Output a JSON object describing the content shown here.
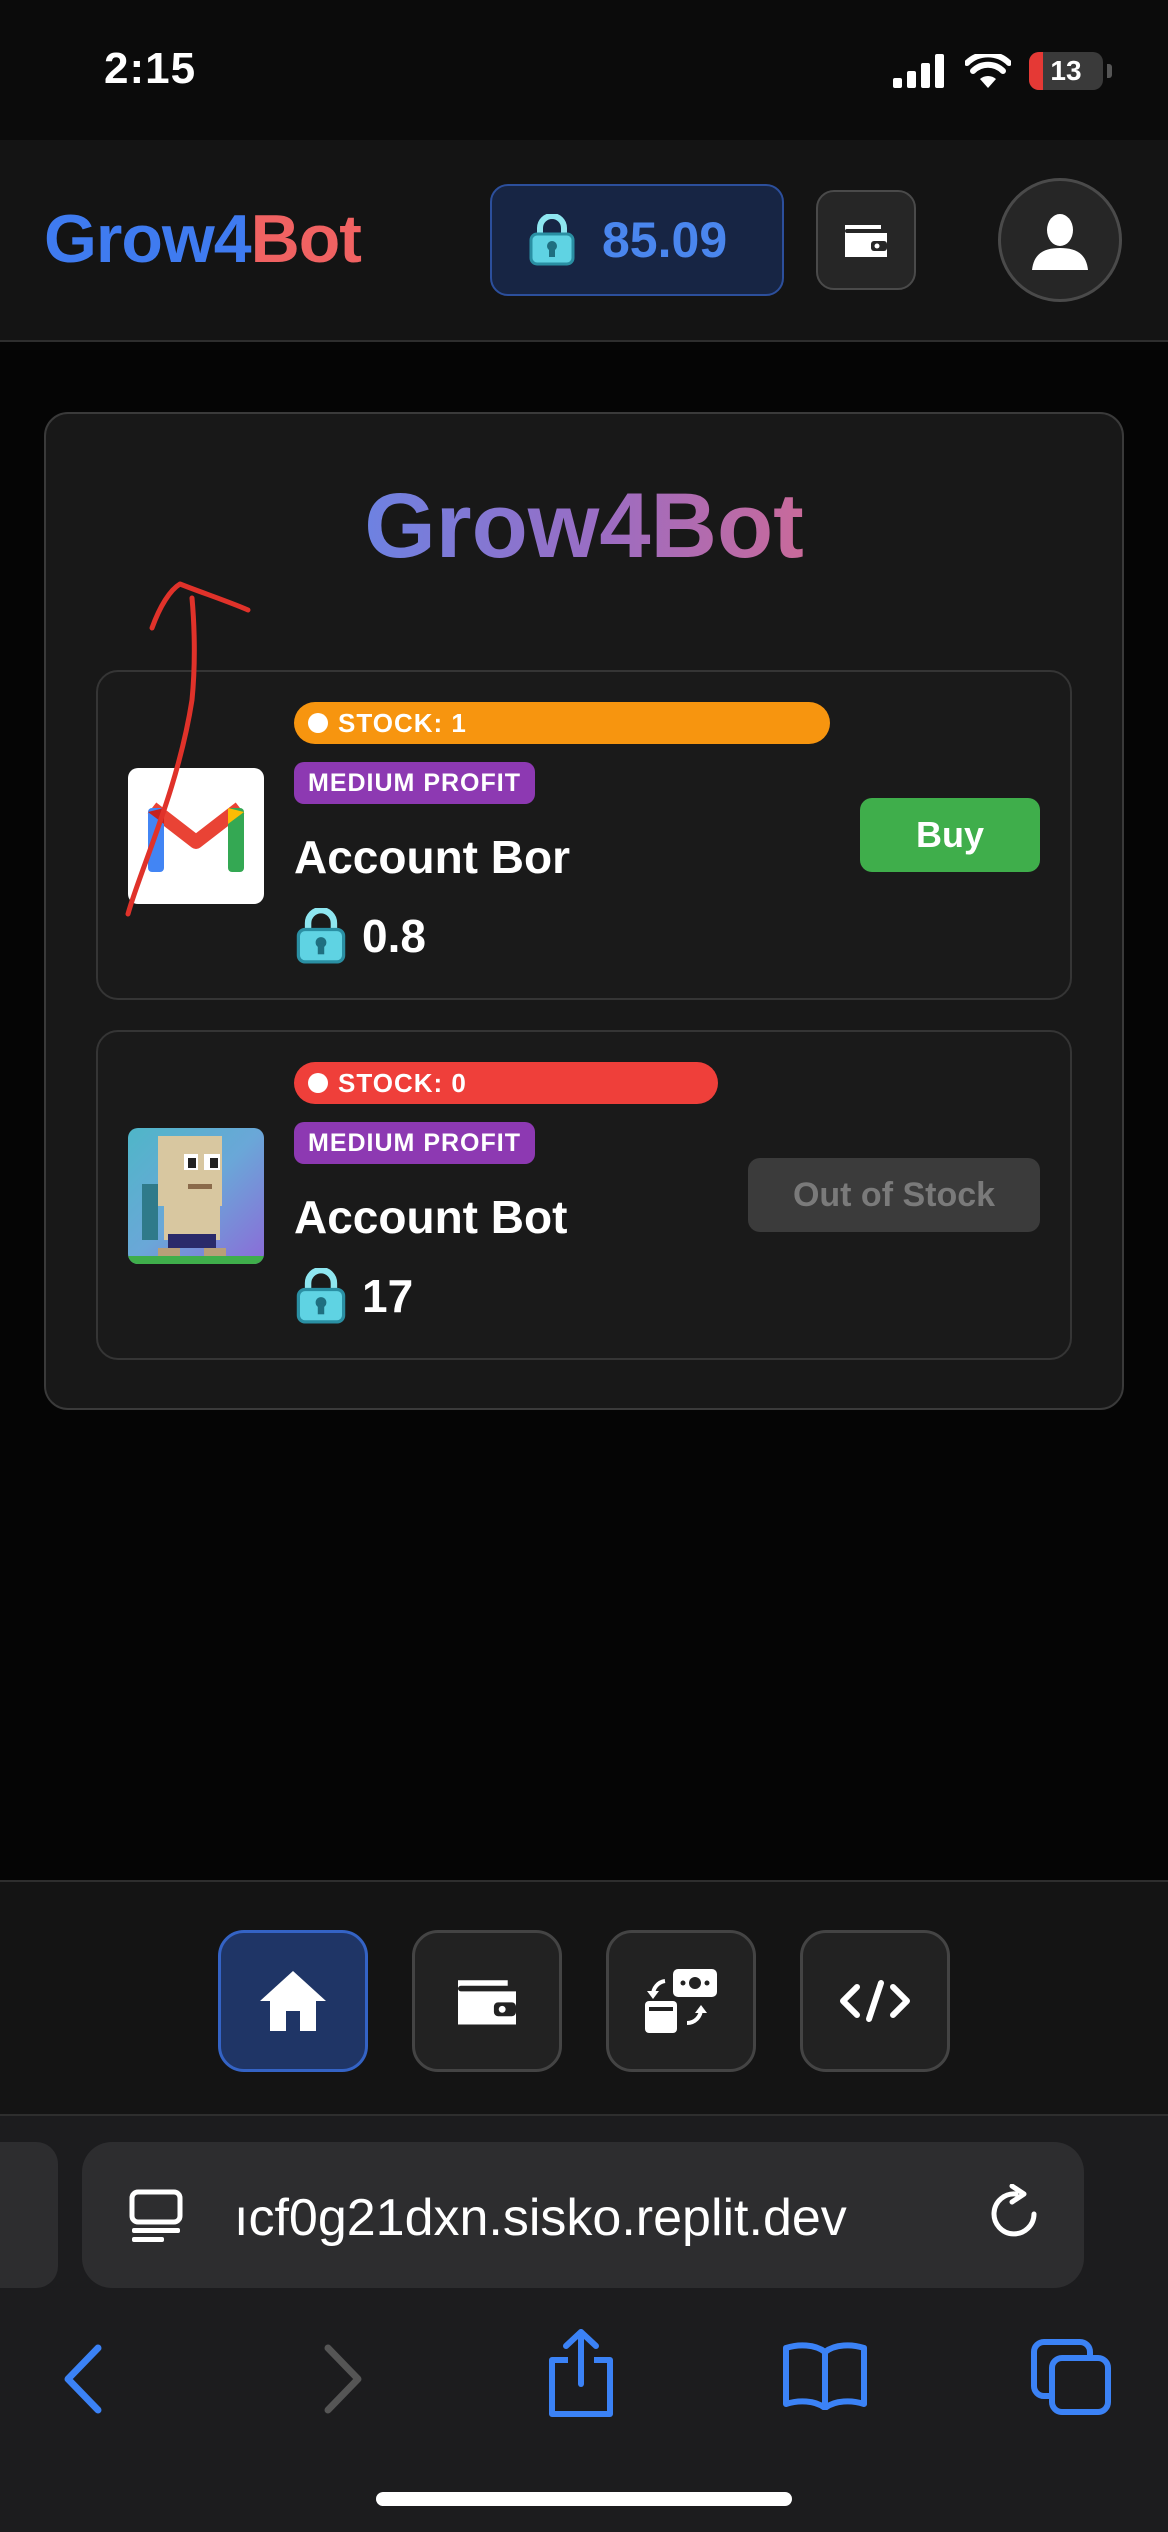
{
  "status_bar": {
    "time": "2:15",
    "battery_level": "13",
    "icons": [
      "cellular-signal-icon",
      "wifi-icon",
      "battery-icon"
    ]
  },
  "header": {
    "brand_part1": "Grow4",
    "brand_part2": "Bot",
    "balance": "85.09",
    "balance_icon": "lock-icon",
    "wallet_icon": "wallet-icon",
    "profile_icon": "user-icon"
  },
  "card": {
    "title": "Grow4Bot"
  },
  "products": [
    {
      "stock_label": "STOCK: 1",
      "badge": "MEDIUM PROFIT",
      "name": "Account Bor",
      "price": "0.8",
      "action": "Buy",
      "thumbnail": "gmail-logo",
      "available": true
    },
    {
      "stock_label": "STOCK: 0",
      "badge": "MEDIUM PROFIT",
      "name": "Account Bot",
      "price": "17",
      "action": "Out of Stock",
      "thumbnail": "growtopia-character",
      "available": false
    }
  ],
  "tab_bar": {
    "items": [
      "home-icon",
      "wallet-icon",
      "exchange-icon",
      "code-icon"
    ],
    "active": "home-icon"
  },
  "browser": {
    "url": "ıcf0g21dxn.sisko.replit.dev",
    "icons": [
      "page-icon",
      "reload-icon",
      "back-icon",
      "forward-icon",
      "share-icon",
      "bookmarks-icon",
      "tabs-icon"
    ]
  },
  "colors": {
    "brand_blue": "#3f7bf0",
    "brand_red": "#f06262",
    "stock_in": "#f7950f",
    "stock_out": "#ef3f3a",
    "profit_badge": "#8d39b2",
    "buy_green": "#3fae4b",
    "accent_blue": "#4a86ee"
  }
}
